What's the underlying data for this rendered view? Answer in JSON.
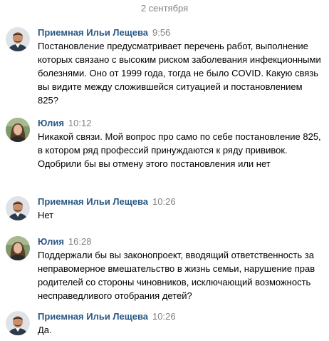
{
  "date_separator": "2 сентября",
  "messages": [
    {
      "author": "Приемная Ильи Лещева",
      "time": "9:56",
      "avatar": "man-photo-avatar",
      "text": "Постановление предусматривает перечень работ, выполнение которых связано с высоким риском заболевания инфекционными болезнями. Оно от 1999 года, тогда не было COVID. Какую связь вы видите между сложившейся ситуацией и постановлением 825?"
    },
    {
      "author": "Юлия",
      "time": "10:12",
      "avatar": "woman-photo-avatar",
      "text": "Никакой связи. Мой вопрос про само по себе постановление 825, в котором ряд профессий принуждаются к ряду прививок. Одобрили бы вы отмену этого постановления или нет"
    },
    {
      "author": "Приемная Ильи Лещева",
      "time": "10:26",
      "avatar": "man-photo-avatar",
      "text": "Нет"
    },
    {
      "author": "Юлия",
      "time": "16:28",
      "avatar": "woman-photo-avatar",
      "text": "Поддержали бы вы законопроект, вводящий ответственность за неправомерное вмешательство в жизнь семьи, нарушение прав родителей со стороны чиновников, исключающий возможность несправедливого отобрания детей?"
    },
    {
      "author": "Приемная Ильи Лещева",
      "time": "10:26",
      "avatar": "man-photo-avatar",
      "text": "Да."
    }
  ]
}
